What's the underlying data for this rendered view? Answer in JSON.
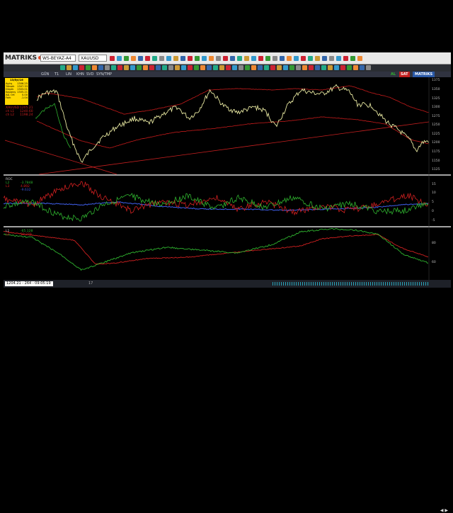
{
  "app": {
    "logo": "MATRIKS",
    "account": "WS-BEYAZ-A4",
    "symbol": "XAUUSD"
  },
  "tabs": [
    {
      "label": "GÜN"
    },
    {
      "label": "T1"
    },
    {
      "label": "LIN"
    },
    {
      "label": "KHN"
    },
    {
      "label": "SVD"
    },
    {
      "label": "SYN/TMP"
    }
  ],
  "header_right": {
    "al": "AL",
    "sat": "SAT",
    "brand": "MATRIKS"
  },
  "info": {
    "title": "13/Eyl/16",
    "rows": [
      {
        "k": "Açılış",
        "v": "1306.25"
      },
      {
        "k": "Yüksek",
        "v": "1307.33"
      },
      {
        "k": "Düşük",
        "v": "1303.01"
      },
      {
        "k": "Kapanış",
        "v": "1305.21"
      },
      {
        "k": "Ağ. Ort",
        "v": "0.00"
      },
      {
        "k": "Fark",
        "v": "-1.04"
      }
    ]
  },
  "legends": {
    "main": [
      "XAUUSD",
      "ch L1",
      "ch L2"
    ],
    "main_values": [
      "1205.21",
      "1240.60",
      "1198.24"
    ],
    "ind1": [
      "ROC",
      "L2",
      "L3"
    ],
    "ind1_values": [
      "-3.7848",
      "4.892",
      "-9.632"
    ],
    "ind2": [
      "L1",
      "L2"
    ],
    "ind2_values": [
      "-65.128",
      "32.278"
    ]
  },
  "axes": {
    "main_ticks": [
      "1375",
      "1350",
      "1325",
      "1300",
      "1275",
      "1250",
      "1225",
      "1200",
      "1175",
      "1150",
      "1125"
    ],
    "ind1_ticks": [
      "15",
      "10",
      "5",
      "0",
      "-5"
    ],
    "ind2_ticks": [
      "80",
      "60"
    ]
  },
  "status": {
    "left": "1204.21 - 264 - 09:05:19",
    "mid": "17",
    "nav": "◀ ▶"
  },
  "colors": {
    "price": "#e7e7a0",
    "channel": "#b01818",
    "trend": "#d03030",
    "green": "#2fb32f",
    "blue": "#3a57d8",
    "red": "#d02020"
  }
}
